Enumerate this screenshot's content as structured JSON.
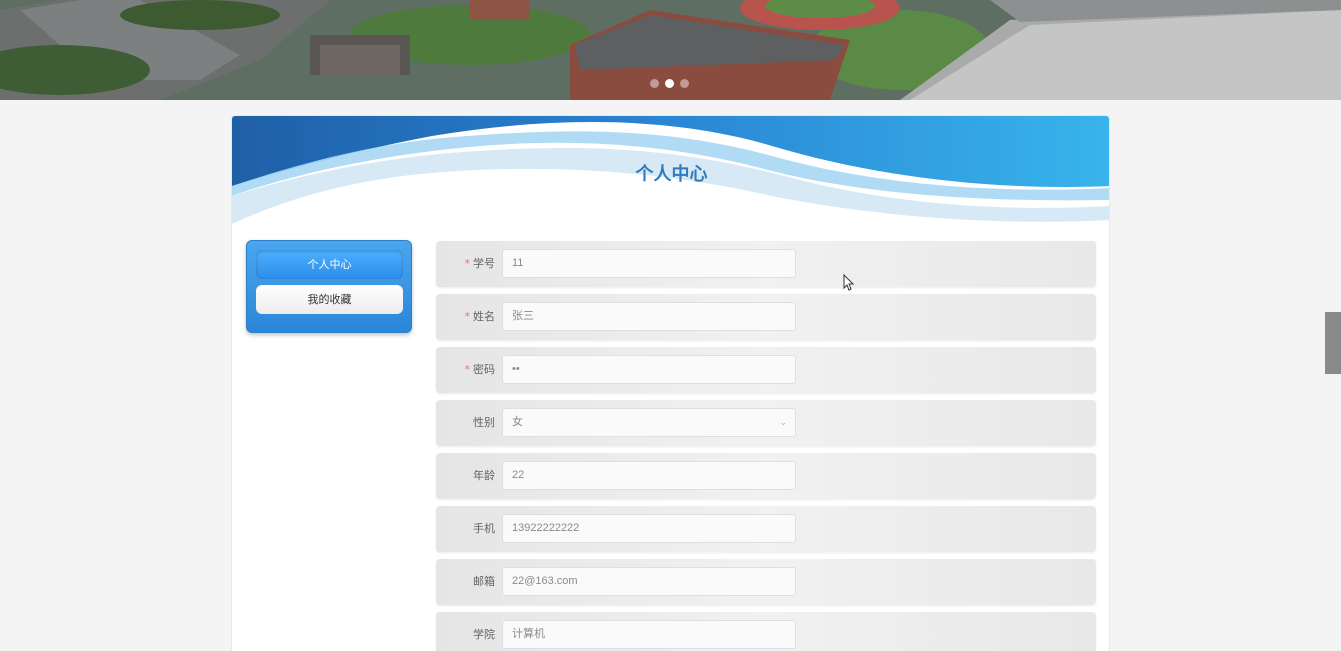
{
  "banner": {
    "carousel_dots": 3,
    "active_dot": 1
  },
  "card": {
    "title": "个人中心"
  },
  "menu": {
    "items": [
      {
        "label": "个人中心",
        "active": true
      },
      {
        "label": "我的收藏",
        "active": false
      }
    ]
  },
  "form": {
    "fields": [
      {
        "label": "学号",
        "required": true,
        "value": "11"
      },
      {
        "label": "姓名",
        "required": true,
        "value": "张三"
      },
      {
        "label": "密码",
        "required": true,
        "value": "••"
      },
      {
        "label": "性别",
        "required": false,
        "value": "女",
        "type": "select"
      },
      {
        "label": "年龄",
        "required": false,
        "value": "22"
      },
      {
        "label": "手机",
        "required": false,
        "value": "13922222222"
      },
      {
        "label": "邮箱",
        "required": false,
        "value": "22@163.com"
      },
      {
        "label": "学院",
        "required": false,
        "value": "计算机"
      }
    ]
  },
  "colors": {
    "accent": "#2e7bbf",
    "required": "#f56c6c",
    "menu_blue": "#2b86d8"
  }
}
